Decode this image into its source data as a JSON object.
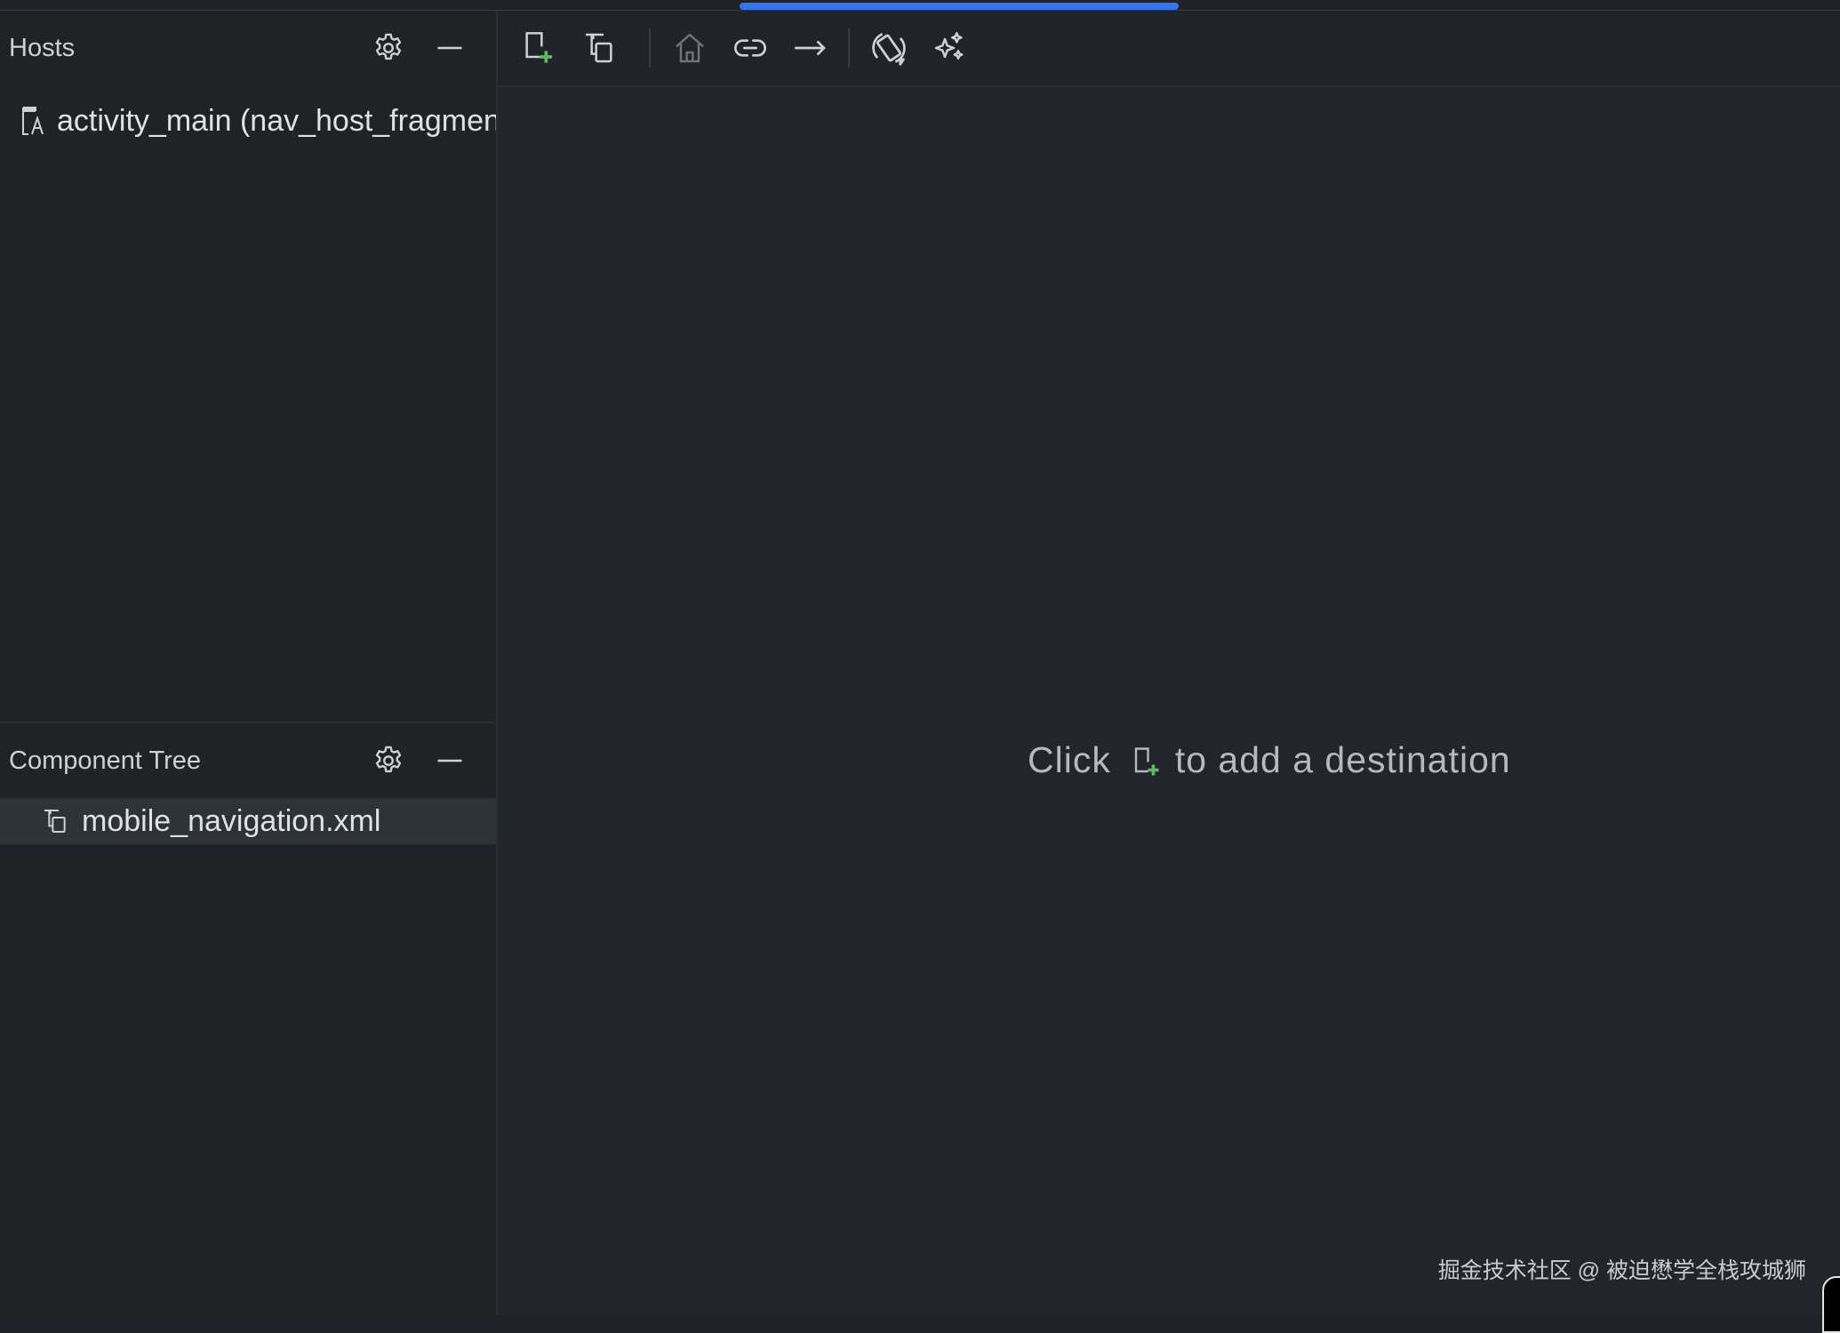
{
  "hosts_panel": {
    "title": "Hosts",
    "items": [
      {
        "label": "activity_main (nav_host_fragmen",
        "icon": "layout-file-icon"
      }
    ]
  },
  "component_tree": {
    "title": "Component Tree",
    "items": [
      {
        "label": "mobile_navigation.xml",
        "icon": "navigation-graph-icon",
        "selected": true
      }
    ]
  },
  "toolbar": {
    "buttons": [
      {
        "name": "new-destination",
        "icon": "new-destination-icon"
      },
      {
        "name": "nested-graph",
        "icon": "nested-graph-icon"
      },
      {
        "name": "assign-start-destination",
        "icon": "home-icon"
      },
      {
        "name": "deep-link",
        "icon": "link-icon"
      },
      {
        "name": "add-action",
        "icon": "arrow-right-icon"
      },
      {
        "name": "auto-arrange",
        "icon": "auto-arrange-icon"
      },
      {
        "name": "ai-assist",
        "icon": "sparkle-icon"
      }
    ]
  },
  "canvas": {
    "hint_prefix": "Click",
    "hint_suffix": "to add a destination"
  },
  "watermark": "掘金技术社区 @ 被迫懋学全栈攻城狮",
  "colors": {
    "accent": "#3574f0",
    "add_green": "#5fb865",
    "background": "#1f2226"
  }
}
